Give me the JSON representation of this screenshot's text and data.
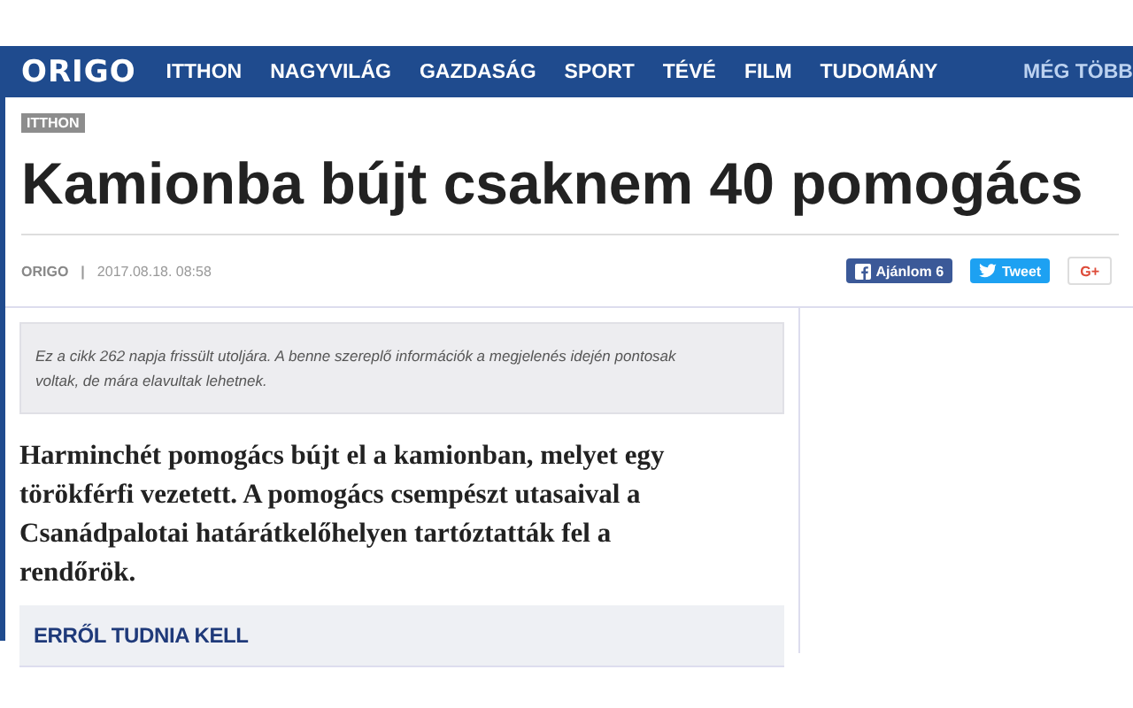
{
  "nav": {
    "logo": "ORIGO",
    "items": [
      "ITTHON",
      "NAGYVILÁG",
      "GAZDASÁG",
      "SPORT",
      "TÉVÉ",
      "FILM",
      "TUDOMÁNY"
    ],
    "more": "MÉG TÖBB"
  },
  "article": {
    "category": "ITTHON",
    "title": "Kamionba bújt csaknem 40 pomogács",
    "source": "ORIGO",
    "separator": "|",
    "date": "2017.08.18. 08:58",
    "share": [
      {
        "kind": "facebook",
        "label": "Ajánlom 6"
      },
      {
        "kind": "twitter",
        "label": "Tweet"
      },
      {
        "kind": "google",
        "label": "G+"
      }
    ],
    "notice": "Ez a cikk 262 napja frissült utoljára. A benne szereplő információk a megjelenés idején pontosak voltak, de mára elavultak lehetnek.",
    "lead": "Harminchét pomogács bújt el a kamionban, melyet egy törökférfi vezetett. A pomogács csempészt utasaival a Csanádpalotai határátkelőhelyen tartóztatták fel a rendőrök.",
    "box_title": "ERRŐL TUDNIA KELL"
  }
}
